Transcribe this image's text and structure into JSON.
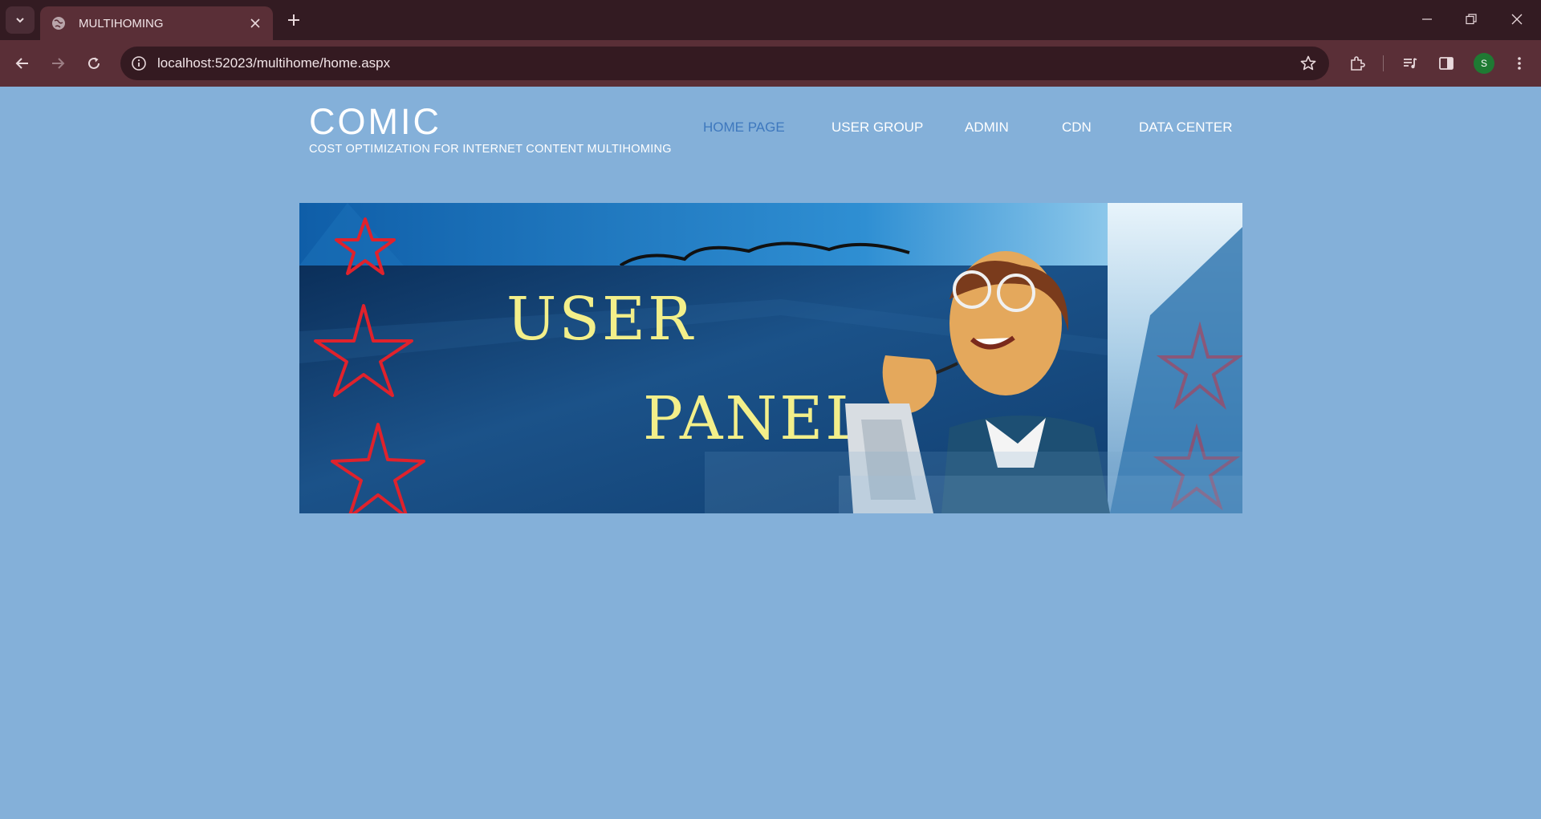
{
  "browser": {
    "tab_title": "MULTIHOMING",
    "url": "localhost:52023/multihome/home.aspx",
    "profile_initial": "S"
  },
  "site": {
    "logo_title": "COMIC",
    "logo_subtitle": "COST OPTIMIZATION FOR INTERNET CONTENT MULTIHOMING"
  },
  "nav": {
    "items": [
      {
        "label": "HOME PAGE",
        "active": true
      },
      {
        "label": "USER GROUP",
        "active": false
      },
      {
        "label": "ADMIN",
        "active": false
      },
      {
        "label": "CDN",
        "active": false
      },
      {
        "label": "DATA CENTER",
        "active": false
      }
    ]
  },
  "banner": {
    "line1": "USER",
    "line2": "PANEL"
  },
  "colors": {
    "page_bg": "#84b0d9",
    "nav_active": "#3e78be",
    "banner_text": "#f3ef8a",
    "star_red": "#e0222c"
  }
}
